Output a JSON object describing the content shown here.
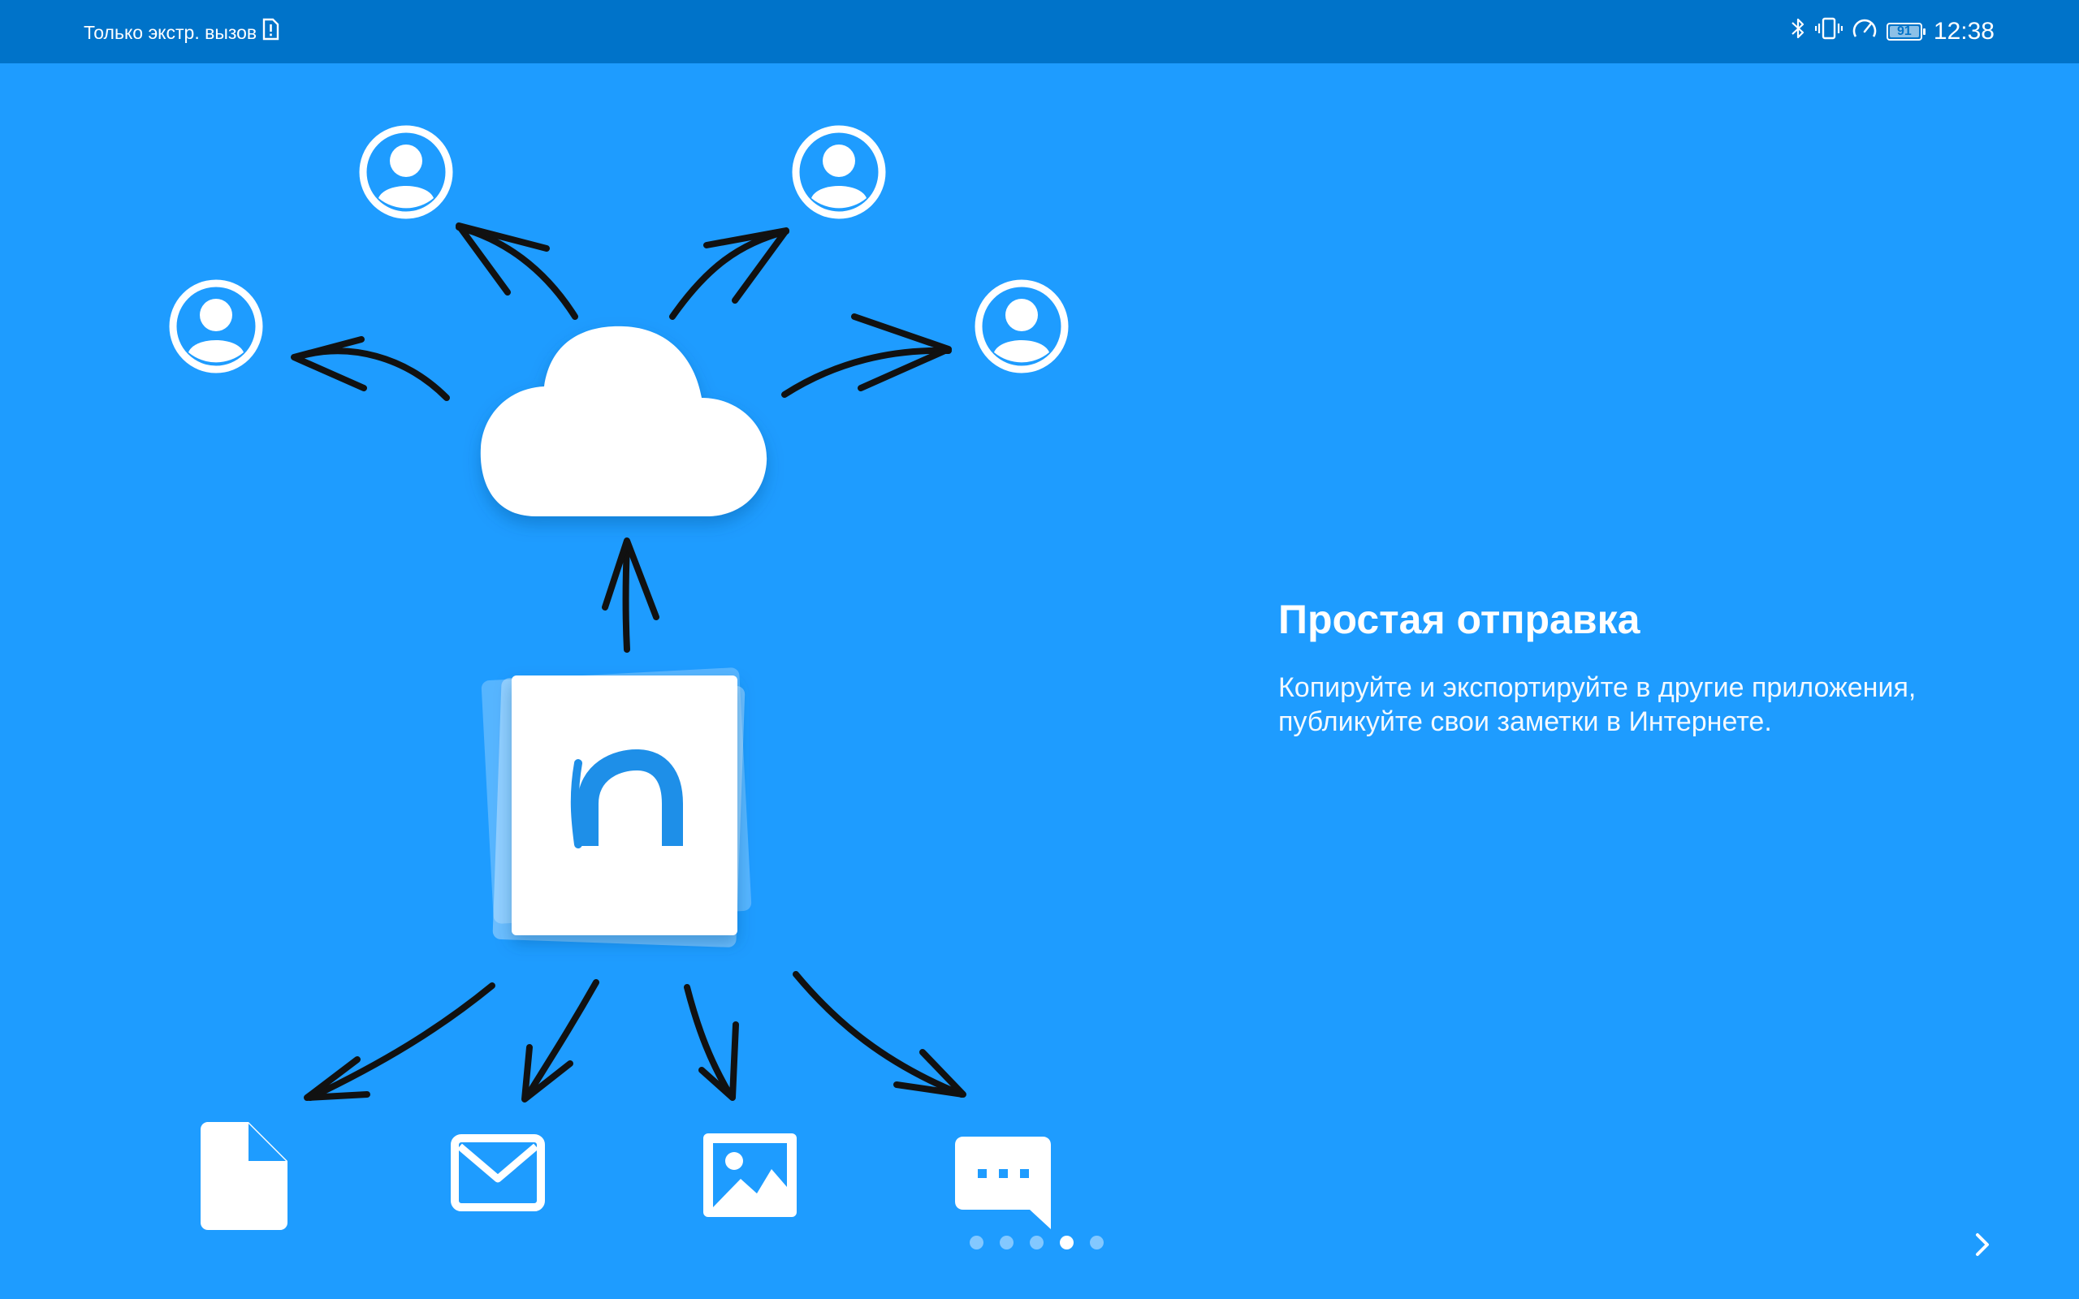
{
  "status_bar": {
    "carrier_text": "Только экстр. вызов",
    "battery_level": "91",
    "time": "12:38",
    "icons": [
      "sim-alert-icon",
      "bluetooth-icon",
      "vibrate-icon",
      "data-saver-icon",
      "battery-icon"
    ]
  },
  "onboarding": {
    "title": "Простая отправка",
    "description": "Копируйте и экспортируйте в другие приложения, публикуйте свои заметки в Интернете.",
    "illustration": {
      "center_icon": "cloud-icon",
      "user_icons": [
        "user-icon",
        "user-icon",
        "user-icon",
        "user-icon"
      ],
      "app_logo": "app-logo-n",
      "export_icons": [
        "file-icon",
        "mail-icon",
        "image-icon",
        "message-icon"
      ]
    },
    "pagination": {
      "total": 5,
      "active_index": 3
    },
    "next_icon": "chevron-right-icon"
  },
  "colors": {
    "background": "#1e9cff",
    "status_bar": "#0073c9",
    "foreground": "#ffffff",
    "arrows": "#111111",
    "logo_blue": "#1e8fe8"
  }
}
